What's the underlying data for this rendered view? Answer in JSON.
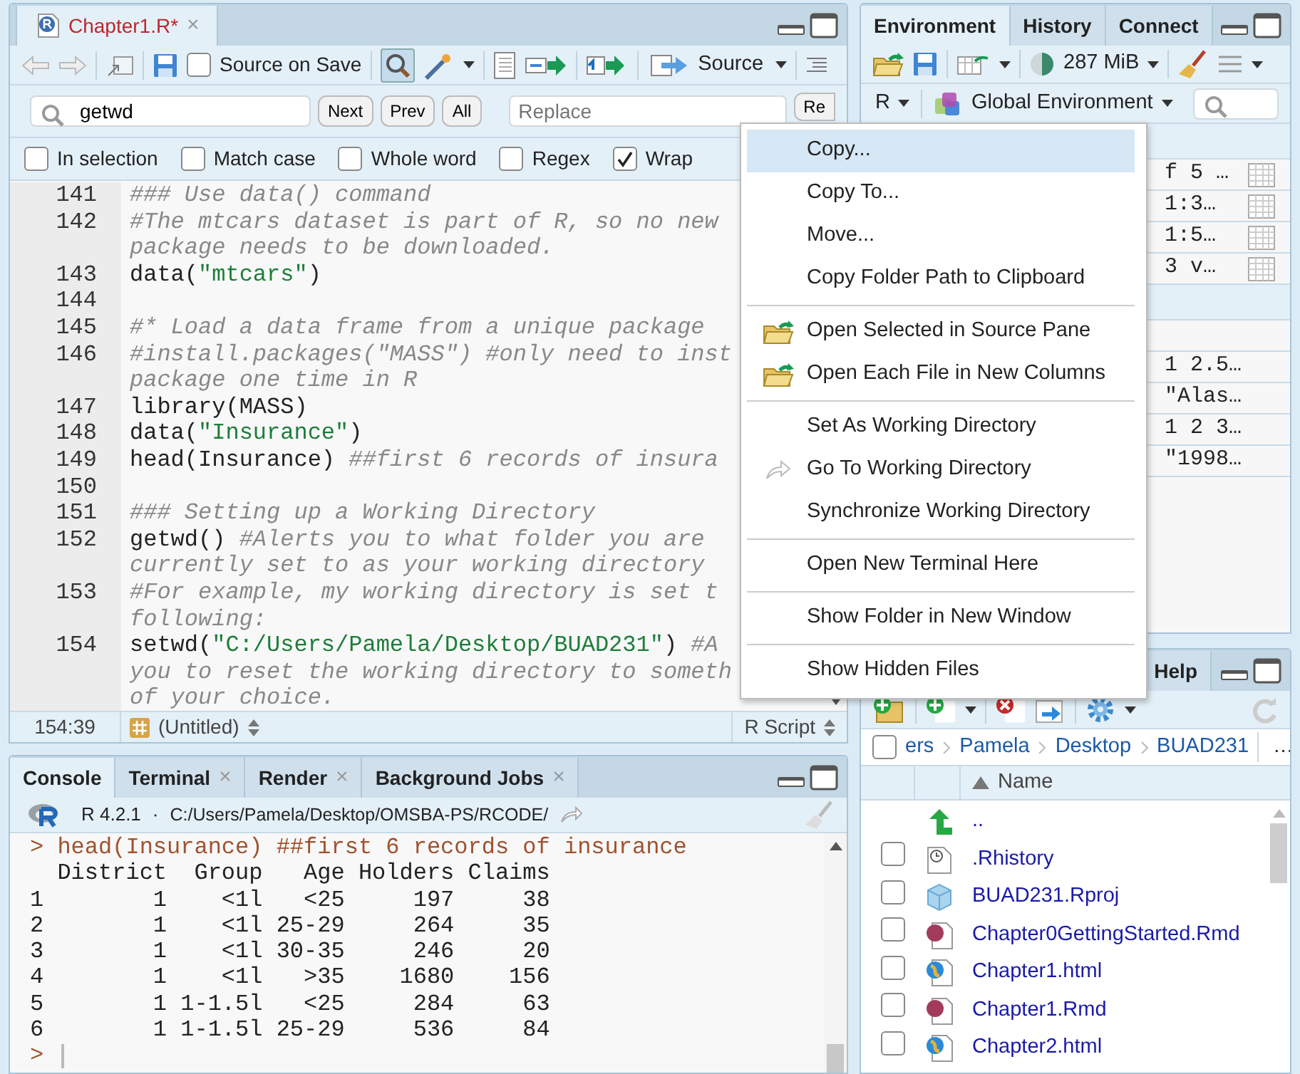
{
  "source_pane": {
    "tabs": [
      {
        "label": "Chapter1.R*",
        "modified": true,
        "selected": true,
        "close": "×"
      }
    ],
    "toolbar": {
      "source_on_save": {
        "label": "Source on Save",
        "checked": false
      },
      "find_on": true,
      "source_button": "Source"
    },
    "find_bar": {
      "search": {
        "value": "getwd"
      },
      "buttons": [
        "Next",
        "Prev",
        "All"
      ],
      "replace": {
        "placeholder": "Replace"
      },
      "replace_button": "Re"
    },
    "options": [
      {
        "label": "In selection",
        "checked": false
      },
      {
        "label": "Match case",
        "checked": false
      },
      {
        "label": "Whole word",
        "checked": false
      },
      {
        "label": "Regex",
        "checked": false
      },
      {
        "label": "Wrap",
        "checked": true
      }
    ],
    "lines": [
      {
        "num": "141",
        "rows": [
          [
            {
              "kind": "comment",
              "text": "### Use data() command"
            }
          ]
        ]
      },
      {
        "num": "142",
        "rows": [
          [
            {
              "kind": "comment",
              "text": "#The mtcars dataset is part of R, so no new"
            }
          ],
          [
            {
              "kind": "comment",
              "text": "package needs to be downloaded."
            }
          ]
        ]
      },
      {
        "num": "143",
        "rows": [
          [
            {
              "kind": "code",
              "text": "data("
            },
            {
              "kind": "string",
              "text": "\"mtcars\""
            },
            {
              "kind": "code",
              "text": ")"
            }
          ]
        ]
      },
      {
        "num": "144"
      },
      {
        "num": "145",
        "rows": [
          [
            {
              "kind": "comment",
              "text": "#* Load a data frame from a unique package"
            }
          ]
        ]
      },
      {
        "num": "146",
        "rows": [
          [
            {
              "kind": "comment",
              "text": "#install.packages(\"MASS\") #only need to inst"
            }
          ],
          [
            {
              "kind": "comment",
              "text": "package one time in R"
            }
          ]
        ]
      },
      {
        "num": "147",
        "rows": [
          [
            {
              "kind": "code",
              "text": "library(MASS)"
            }
          ]
        ]
      },
      {
        "num": "148",
        "rows": [
          [
            {
              "kind": "code",
              "text": "data("
            },
            {
              "kind": "string",
              "text": "\"Insurance\""
            },
            {
              "kind": "code",
              "text": ")"
            }
          ]
        ]
      },
      {
        "num": "149",
        "rows": [
          [
            {
              "kind": "code",
              "text": "head(Insurance) "
            },
            {
              "kind": "comment",
              "text": "##first 6 records of insura"
            }
          ]
        ]
      },
      {
        "num": "150"
      },
      {
        "num": "151",
        "rows": [
          [
            {
              "kind": "comment",
              "text": "### Setting up a Working Directory"
            }
          ]
        ]
      },
      {
        "num": "152",
        "rows": [
          [
            {
              "kind": "code",
              "text": "getwd() "
            },
            {
              "kind": "comment",
              "text": "#Alerts you to what folder you are"
            }
          ],
          [
            {
              "kind": "comment",
              "text": "currently set to as your working directory"
            }
          ]
        ]
      },
      {
        "num": "153",
        "rows": [
          [
            {
              "kind": "comment",
              "text": "#For example, my working directory is set t"
            }
          ],
          [
            {
              "kind": "comment",
              "text": "following:"
            }
          ]
        ]
      },
      {
        "num": "154",
        "rows": [
          [
            {
              "kind": "code",
              "text": "setwd("
            },
            {
              "kind": "string",
              "text": "\"C:/Users/Pamela/Desktop/BUAD231\""
            },
            {
              "kind": "code",
              "text": ") "
            },
            {
              "kind": "comment",
              "text": "#A"
            }
          ],
          [
            {
              "kind": "comment",
              "text": "you to reset the working directory to someth"
            }
          ],
          [
            {
              "kind": "comment",
              "text": "of your choice."
            }
          ]
        ]
      }
    ],
    "status_bar": {
      "position": "154:39",
      "scope": "(Untitled)",
      "file_type": "R Script"
    }
  },
  "console_pane": {
    "tabs": [
      {
        "label": "Console",
        "selected": true
      },
      {
        "label": "Terminal",
        "selected": false,
        "close": "×"
      },
      {
        "label": "Render",
        "selected": false,
        "close": "×"
      },
      {
        "label": "Background Jobs",
        "selected": false,
        "close": "×"
      }
    ],
    "version": "R 4.2.1",
    "separator": "·",
    "path": "C:/Users/Pamela/Desktop/OMSBA-PS/RCODE/",
    "lines": [
      {
        "kind": "input",
        "text": "> head(Insurance) ##first 6 records of insurance"
      },
      {
        "kind": "output",
        "text": "  District  Group   Age Holders Claims"
      },
      {
        "kind": "output",
        "text": "1        1    <1l   <25     197     38"
      },
      {
        "kind": "output",
        "text": "2        1    <1l 25-29     264     35"
      },
      {
        "kind": "output",
        "text": "3        1    <1l 30-35     246     20"
      },
      {
        "kind": "output",
        "text": "4        1    <1l   >35    1680    156"
      },
      {
        "kind": "output",
        "text": "5        1 1-1.5l   <25     284     63"
      },
      {
        "kind": "output",
        "text": "6        1 1-1.5l 25-29     536     84"
      },
      {
        "kind": "prompt",
        "text": ">"
      }
    ]
  },
  "environment_pane": {
    "tabs": [
      {
        "label": "Environment",
        "selected": true
      },
      {
        "label": "History",
        "selected": false
      },
      {
        "label": "Connect",
        "selected": false
      }
    ],
    "memory": "287 MiB",
    "language": "R",
    "scope": "Global Environment",
    "rows": [
      {
        "kind": "header"
      },
      {
        "kind": "data",
        "value": "f 5 …"
      },
      {
        "kind": "data",
        "value": "1:3…"
      },
      {
        "kind": "data",
        "value": "1:5…"
      },
      {
        "kind": "data",
        "value": "3 v…"
      },
      {
        "kind": "header"
      },
      {
        "kind": "value"
      },
      {
        "kind": "value",
        "value": "1 2.5…"
      },
      {
        "kind": "value",
        "value": "\"Alas…"
      },
      {
        "kind": "value",
        "value": "1 2 3…"
      },
      {
        "kind": "value",
        "value": "\"1998…"
      }
    ]
  },
  "files_pane": {
    "tabs": [
      {
        "label": "Help",
        "selected": false
      }
    ],
    "select_all": {
      "checked": false
    },
    "breadcrumb": [
      "ers",
      "Pamela",
      "Desktop",
      "BUAD231"
    ],
    "more": "…",
    "column": "Name",
    "files": [
      {
        "kind": "parent",
        "name": ".."
      },
      {
        "kind": "history",
        "name": ".Rhistory",
        "checked": false
      },
      {
        "kind": "project",
        "name": "BUAD231.Rproj",
        "checked": false
      },
      {
        "kind": "rmd",
        "name": "Chapter0GettingStarted.Rmd",
        "checked": false
      },
      {
        "kind": "html",
        "name": "Chapter1.html",
        "checked": false
      },
      {
        "kind": "rmd",
        "name": "Chapter1.Rmd",
        "checked": false
      },
      {
        "kind": "html",
        "name": "Chapter2.html",
        "checked": false
      }
    ]
  },
  "context_menu": {
    "groups": [
      [
        {
          "kind": "plain",
          "label": "Copy...",
          "selected": true
        },
        {
          "kind": "plain",
          "label": "Copy To...",
          "selected": false
        },
        {
          "kind": "plain",
          "label": "Move...",
          "selected": false
        },
        {
          "kind": "plain",
          "label": "Copy Folder Path to Clipboard",
          "selected": false
        }
      ],
      [
        {
          "kind": "open",
          "label": "Open Selected in Source Pane",
          "selected": false
        },
        {
          "kind": "open",
          "label": "Open Each File in New Columns",
          "selected": false
        }
      ],
      [
        {
          "kind": "plain",
          "label": "Set As Working Directory",
          "selected": false
        },
        {
          "kind": "goto",
          "label": "Go To Working Directory",
          "selected": false
        },
        {
          "kind": "plain",
          "label": "Synchronize Working Directory",
          "selected": false
        }
      ],
      [
        {
          "kind": "plain",
          "label": "Open New Terminal Here",
          "selected": false
        }
      ],
      [
        {
          "kind": "plain",
          "label": "Show Folder in New Window",
          "selected": false
        }
      ],
      [
        {
          "kind": "plain",
          "label": "Show Hidden Files",
          "selected": false
        }
      ]
    ]
  }
}
